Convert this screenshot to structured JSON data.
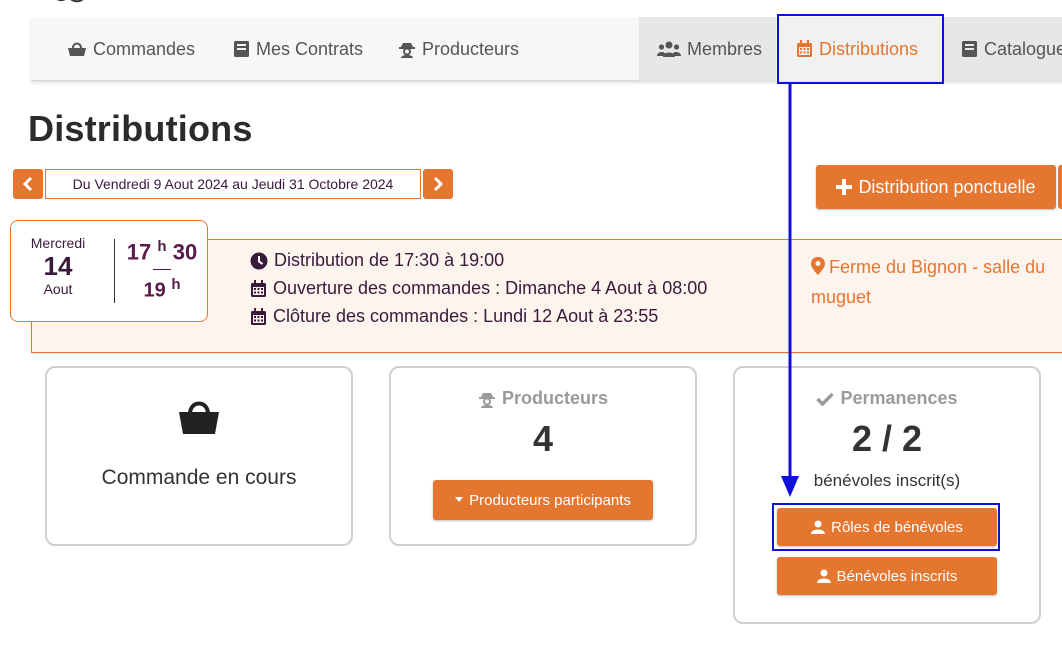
{
  "nav": {
    "commandes": "Commandes",
    "contrats": "Mes Contrats",
    "producteurs": "Producteurs",
    "membres": "Membres",
    "distributions": "Distributions",
    "catalogue": "Catalogue"
  },
  "page": {
    "title": "Distributions"
  },
  "range": {
    "label": "Du Vendredi 9 Aout 2024 au Jeudi 31 Octobre 2024"
  },
  "actions": {
    "new_distribution": "Distribution ponctuelle"
  },
  "distribution": {
    "day_name": "Mercredi",
    "day_number": "14",
    "month": "Aout",
    "start_hour": "17",
    "start_min": "30",
    "end_hour": "19",
    "hour_suffix": "h",
    "time_line": "Distribution de 17:30 à 19:00",
    "opening_line": "Ouverture des commandes : Dimanche 4 Aout à 08:00",
    "closing_line": "Clôture des commandes : Lundi 12 Aout à 23:55",
    "place": "Ferme du Bignon - salle du muguet"
  },
  "cards": {
    "order": {
      "label": "Commande en cours"
    },
    "producers": {
      "title": "Producteurs",
      "count": "4",
      "button": "Producteurs participants"
    },
    "permanences": {
      "title": "Permanences",
      "count": "2 / 2",
      "subtitle": "bénévoles inscrit(s)",
      "roles_button": "Rôles de bénévoles",
      "volunteers_button": "Bénévoles inscrits"
    }
  },
  "colors": {
    "accent": "#e5762f",
    "annotation": "#1010d8",
    "date_text": "#5a1a4a"
  }
}
